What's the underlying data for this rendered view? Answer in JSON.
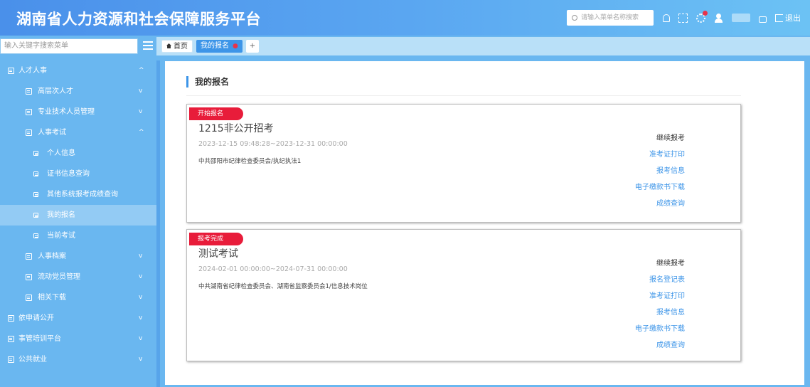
{
  "header": {
    "title": "湖南省人力资源和社会保障服务平台",
    "search_placeholder": "请输入菜单名称搜索",
    "logout_label": "退出"
  },
  "menu_search": {
    "placeholder": "输入关键字搜索菜单"
  },
  "tabs": {
    "home": "首页",
    "active": "我的报名",
    "add": "+"
  },
  "sidebar": {
    "items": [
      {
        "label": "人才人事",
        "chevron": "^"
      },
      {
        "label": "高层次人才",
        "chevron": "v"
      },
      {
        "label": "专业技术人员管理",
        "chevron": "v"
      },
      {
        "label": "人事考试",
        "chevron": "^"
      },
      {
        "label": "个人信息"
      },
      {
        "label": "证书信息查询"
      },
      {
        "label": "其他系统报考成绩查询"
      },
      {
        "label": "我的报名"
      },
      {
        "label": "当前考试"
      },
      {
        "label": "人事档案",
        "chevron": "v"
      },
      {
        "label": "流动党员管理",
        "chevron": "v"
      },
      {
        "label": "相关下载",
        "chevron": "v"
      },
      {
        "label": "依申请公开",
        "chevron": "v"
      },
      {
        "label": "事管培训平台",
        "chevron": "v"
      },
      {
        "label": "公共就业",
        "chevron": "v"
      }
    ]
  },
  "main": {
    "title": "我的报名",
    "cards": [
      {
        "badge": "开始报名",
        "name": "1215非公开招考",
        "time": "2023-12-15 09:48:28~2023-12-31 00:00:00",
        "org": "中共邵阳市纪律检查委员会/执纪执法1",
        "actions": [
          {
            "label": "继续报考",
            "style": "plain"
          },
          {
            "label": "准考证打印",
            "style": "link"
          },
          {
            "label": "报考信息",
            "style": "link"
          },
          {
            "label": "电子缴款书下载",
            "style": "link"
          },
          {
            "label": "成绩查询",
            "style": "link"
          }
        ]
      },
      {
        "badge": "报考完成",
        "name": "测试考试",
        "time": "2024-02-01 00:00:00~2024-07-31 00:00:00",
        "org": "中共湖南省纪律检查委员会、湖南省监察委员会1/信息技术岗位",
        "actions": [
          {
            "label": "继续报考",
            "style": "plain"
          },
          {
            "label": "报名登记表",
            "style": "link"
          },
          {
            "label": "准考证打印",
            "style": "link"
          },
          {
            "label": "报考信息",
            "style": "link"
          },
          {
            "label": "电子缴款书下载",
            "style": "link"
          },
          {
            "label": "成绩查询",
            "style": "link"
          }
        ]
      }
    ]
  },
  "colors": {
    "accent": "#3d95e8",
    "badge": "#e81c3a",
    "sidebar": "#6ab7f0"
  }
}
